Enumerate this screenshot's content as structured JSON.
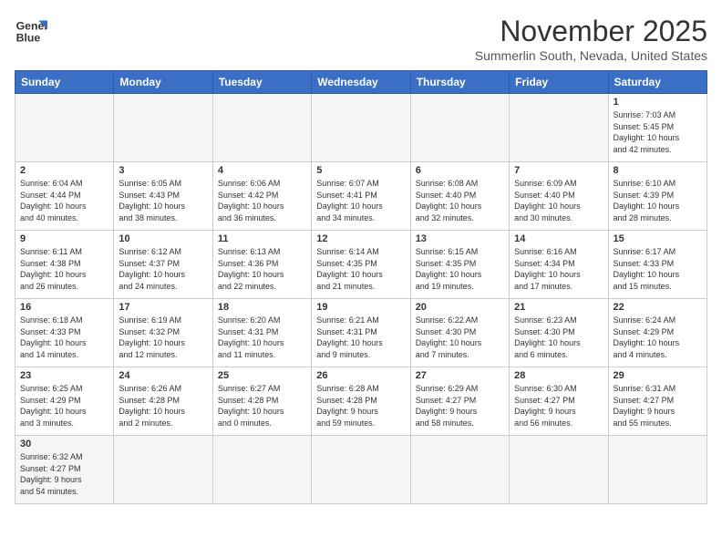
{
  "logo": {
    "line1": "General",
    "line2": "Blue"
  },
  "title": "November 2025",
  "subtitle": "Summerlin South, Nevada, United States",
  "days_of_week": [
    "Sunday",
    "Monday",
    "Tuesday",
    "Wednesday",
    "Thursday",
    "Friday",
    "Saturday"
  ],
  "weeks": [
    [
      {
        "day": "",
        "info": "",
        "empty": true
      },
      {
        "day": "",
        "info": "",
        "empty": true
      },
      {
        "day": "",
        "info": "",
        "empty": true
      },
      {
        "day": "",
        "info": "",
        "empty": true
      },
      {
        "day": "",
        "info": "",
        "empty": true
      },
      {
        "day": "",
        "info": "",
        "empty": true
      },
      {
        "day": "1",
        "info": "Sunrise: 7:03 AM\nSunset: 5:45 PM\nDaylight: 10 hours\nand 42 minutes."
      }
    ],
    [
      {
        "day": "2",
        "info": "Sunrise: 6:04 AM\nSunset: 4:44 PM\nDaylight: 10 hours\nand 40 minutes."
      },
      {
        "day": "3",
        "info": "Sunrise: 6:05 AM\nSunset: 4:43 PM\nDaylight: 10 hours\nand 38 minutes."
      },
      {
        "day": "4",
        "info": "Sunrise: 6:06 AM\nSunset: 4:42 PM\nDaylight: 10 hours\nand 36 minutes."
      },
      {
        "day": "5",
        "info": "Sunrise: 6:07 AM\nSunset: 4:41 PM\nDaylight: 10 hours\nand 34 minutes."
      },
      {
        "day": "6",
        "info": "Sunrise: 6:08 AM\nSunset: 4:40 PM\nDaylight: 10 hours\nand 32 minutes."
      },
      {
        "day": "7",
        "info": "Sunrise: 6:09 AM\nSunset: 4:40 PM\nDaylight: 10 hours\nand 30 minutes."
      },
      {
        "day": "8",
        "info": "Sunrise: 6:10 AM\nSunset: 4:39 PM\nDaylight: 10 hours\nand 28 minutes."
      }
    ],
    [
      {
        "day": "9",
        "info": "Sunrise: 6:11 AM\nSunset: 4:38 PM\nDaylight: 10 hours\nand 26 minutes."
      },
      {
        "day": "10",
        "info": "Sunrise: 6:12 AM\nSunset: 4:37 PM\nDaylight: 10 hours\nand 24 minutes."
      },
      {
        "day": "11",
        "info": "Sunrise: 6:13 AM\nSunset: 4:36 PM\nDaylight: 10 hours\nand 22 minutes."
      },
      {
        "day": "12",
        "info": "Sunrise: 6:14 AM\nSunset: 4:35 PM\nDaylight: 10 hours\nand 21 minutes."
      },
      {
        "day": "13",
        "info": "Sunrise: 6:15 AM\nSunset: 4:35 PM\nDaylight: 10 hours\nand 19 minutes."
      },
      {
        "day": "14",
        "info": "Sunrise: 6:16 AM\nSunset: 4:34 PM\nDaylight: 10 hours\nand 17 minutes."
      },
      {
        "day": "15",
        "info": "Sunrise: 6:17 AM\nSunset: 4:33 PM\nDaylight: 10 hours\nand 15 minutes."
      }
    ],
    [
      {
        "day": "16",
        "info": "Sunrise: 6:18 AM\nSunset: 4:33 PM\nDaylight: 10 hours\nand 14 minutes."
      },
      {
        "day": "17",
        "info": "Sunrise: 6:19 AM\nSunset: 4:32 PM\nDaylight: 10 hours\nand 12 minutes."
      },
      {
        "day": "18",
        "info": "Sunrise: 6:20 AM\nSunset: 4:31 PM\nDaylight: 10 hours\nand 11 minutes."
      },
      {
        "day": "19",
        "info": "Sunrise: 6:21 AM\nSunset: 4:31 PM\nDaylight: 10 hours\nand 9 minutes."
      },
      {
        "day": "20",
        "info": "Sunrise: 6:22 AM\nSunset: 4:30 PM\nDaylight: 10 hours\nand 7 minutes."
      },
      {
        "day": "21",
        "info": "Sunrise: 6:23 AM\nSunset: 4:30 PM\nDaylight: 10 hours\nand 6 minutes."
      },
      {
        "day": "22",
        "info": "Sunrise: 6:24 AM\nSunset: 4:29 PM\nDaylight: 10 hours\nand 4 minutes."
      }
    ],
    [
      {
        "day": "23",
        "info": "Sunrise: 6:25 AM\nSunset: 4:29 PM\nDaylight: 10 hours\nand 3 minutes."
      },
      {
        "day": "24",
        "info": "Sunrise: 6:26 AM\nSunset: 4:28 PM\nDaylight: 10 hours\nand 2 minutes."
      },
      {
        "day": "25",
        "info": "Sunrise: 6:27 AM\nSunset: 4:28 PM\nDaylight: 10 hours\nand 0 minutes."
      },
      {
        "day": "26",
        "info": "Sunrise: 6:28 AM\nSunset: 4:28 PM\nDaylight: 9 hours\nand 59 minutes."
      },
      {
        "day": "27",
        "info": "Sunrise: 6:29 AM\nSunset: 4:27 PM\nDaylight: 9 hours\nand 58 minutes."
      },
      {
        "day": "28",
        "info": "Sunrise: 6:30 AM\nSunset: 4:27 PM\nDaylight: 9 hours\nand 56 minutes."
      },
      {
        "day": "29",
        "info": "Sunrise: 6:31 AM\nSunset: 4:27 PM\nDaylight: 9 hours\nand 55 minutes."
      }
    ],
    [
      {
        "day": "30",
        "info": "Sunrise: 6:32 AM\nSunset: 4:27 PM\nDaylight: 9 hours\nand 54 minutes.",
        "last": true
      },
      {
        "day": "",
        "info": "",
        "empty": true,
        "last": true
      },
      {
        "day": "",
        "info": "",
        "empty": true,
        "last": true
      },
      {
        "day": "",
        "info": "",
        "empty": true,
        "last": true
      },
      {
        "day": "",
        "info": "",
        "empty": true,
        "last": true
      },
      {
        "day": "",
        "info": "",
        "empty": true,
        "last": true
      },
      {
        "day": "",
        "info": "",
        "empty": true,
        "last": true
      }
    ]
  ]
}
